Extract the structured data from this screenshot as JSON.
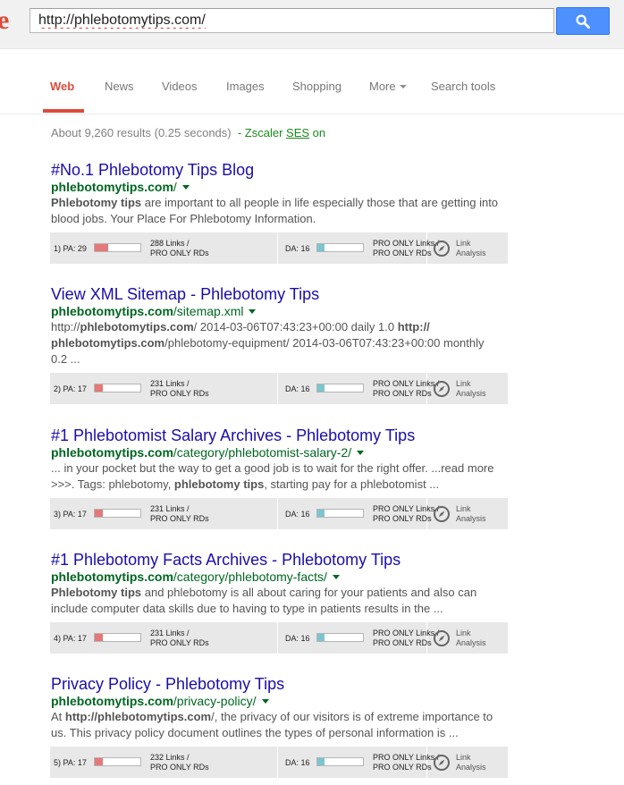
{
  "header": {
    "logo_fragment": "e",
    "search_value": "http://phlebotomytips.com/"
  },
  "tabs": [
    {
      "label": "Web",
      "active": true
    },
    {
      "label": "News"
    },
    {
      "label": "Videos"
    },
    {
      "label": "Images"
    },
    {
      "label": "Shopping"
    },
    {
      "label": "More"
    },
    {
      "label": "Search tools"
    }
  ],
  "stats": {
    "text": "About 9,260 results (0.25 seconds)",
    "zscaler_prefix": "- Zscaler ",
    "zscaler_link": "SES",
    "zscaler_suffix": " on"
  },
  "colors": {
    "accent": "#dd4b39",
    "link": "#1a0dab",
    "url": "#006621",
    "search_button": "#4d90fe",
    "pa_bar": "#e57878",
    "da_bar": "#7cc5cf"
  },
  "results": [
    {
      "title": "#No.1 Phlebotomy Tips Blog",
      "url_domain": "phlebotomytips.com",
      "url_path": "/",
      "snippet_html": "<b>Phlebotomy tips</b> are important to all people in life especially those that are getting into blood jobs. Your Place For Phlebotomy Information.",
      "seo": {
        "rank": "1)",
        "pa_text": "PA: 29",
        "pa_value": 29,
        "links_line1": "288 Links /",
        "links_line2": "PRO ONLY RDs",
        "da_text": "DA: 16",
        "da_value": 16,
        "da_links_line1": "PRO ONLY Links /",
        "da_links_line2": "PRO ONLY RDs",
        "la_line1": "Link",
        "la_line2": "Analysis"
      }
    },
    {
      "title": "View XML Sitemap - Phlebotomy Tips",
      "url_domain": "phlebotomytips.com",
      "url_path": "/sitemap.xml",
      "snippet_html": "http://<b>phlebotomytips.com</b>/ 2014-03-06T07:43:23+00:00 daily 1.0 <b>http://</b><br><b>phlebotomytips.com</b>/phlebotomy-equipment/ 2014-03-06T07:43:23+00:00 monthly<br>0.2 ...",
      "seo": {
        "rank": "2)",
        "pa_text": "PA: 17",
        "pa_value": 17,
        "links_line1": "231 Links /",
        "links_line2": "PRO ONLY RDs",
        "da_text": "DA: 16",
        "da_value": 16,
        "da_links_line1": "PRO ONLY Links /",
        "da_links_line2": "PRO ONLY RDs",
        "la_line1": "Link",
        "la_line2": "Analysis"
      }
    },
    {
      "title": "#1 Phlebotomist Salary Archives - Phlebotomy Tips",
      "url_domain": "phlebotomytips.com",
      "url_path": "/category/phlebotomist-salary-2/",
      "snippet_html": "... in your pocket but the way to get a good job is to wait for the right offer. ...read more &gt;&gt;&gt;. Tags: phlebotomy, <b>phlebotomy tips</b>, starting pay for a phlebotomist ...",
      "seo": {
        "rank": "3)",
        "pa_text": "PA: 17",
        "pa_value": 17,
        "links_line1": "231 Links /",
        "links_line2": "PRO ONLY RDs",
        "da_text": "DA: 16",
        "da_value": 16,
        "da_links_line1": "PRO ONLY Links /",
        "da_links_line2": "PRO ONLY RDs",
        "la_line1": "Link",
        "la_line2": "Analysis"
      }
    },
    {
      "title": "#1 Phlebotomy Facts Archives - Phlebotomy Tips",
      "url_domain": "phlebotomytips.com",
      "url_path": "/category/phlebotomy-facts/",
      "snippet_html": "<b>Phlebotomy tips</b> and phlebotomy is all about caring for your patients and also can include computer data skills due to having to type in patients results in the ...",
      "seo": {
        "rank": "4)",
        "pa_text": "PA: 17",
        "pa_value": 17,
        "links_line1": "231 Links /",
        "links_line2": "PRO ONLY RDs",
        "da_text": "DA: 16",
        "da_value": 16,
        "da_links_line1": "PRO ONLY Links /",
        "da_links_line2": "PRO ONLY RDs",
        "la_line1": "Link",
        "la_line2": "Analysis"
      }
    },
    {
      "title": "Privacy Policy - Phlebotomy Tips",
      "url_domain": "phlebotomytips.com",
      "url_path": "/privacy-policy/",
      "snippet_html": "At <b>http://phlebotomytips.com</b>/, the privacy of our visitors is of extreme importance to us. This privacy policy document outlines the types of personal information is ...",
      "seo": {
        "rank": "5)",
        "pa_text": "PA: 17",
        "pa_value": 17,
        "links_line1": "232 Links /",
        "links_line2": "PRO ONLY RDs",
        "da_text": "DA: 16",
        "da_value": 16,
        "da_links_line1": "PRO ONLY Links /",
        "da_links_line2": "PRO ONLY RDs",
        "la_line1": "Link",
        "la_line2": "Analysis"
      }
    }
  ]
}
